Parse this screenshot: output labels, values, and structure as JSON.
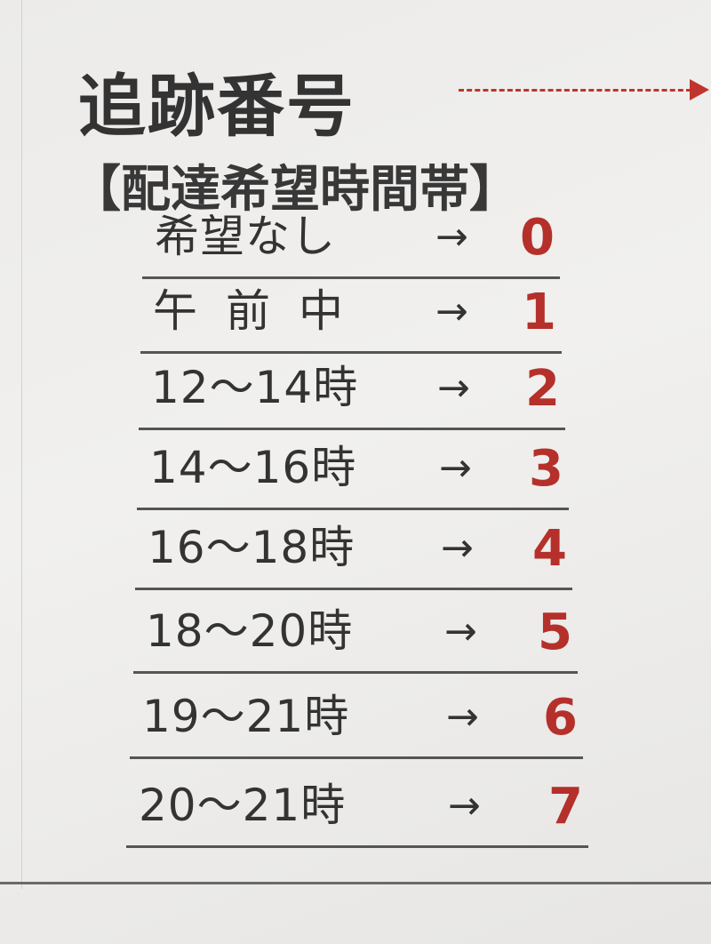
{
  "heading": {
    "title": "追跡番号",
    "subtitle": "【配達希望時間帯】"
  },
  "arrow_glyph": "→",
  "rows": [
    {
      "label": "希望なし",
      "code": "0"
    },
    {
      "label": "午前中",
      "code": "1"
    },
    {
      "label": "12〜14時",
      "code": "2"
    },
    {
      "label": "14〜16時",
      "code": "3"
    },
    {
      "label": "16〜18時",
      "code": "4"
    },
    {
      "label": "18〜20時",
      "code": "5"
    },
    {
      "label": "19〜21時",
      "code": "6"
    },
    {
      "label": "20〜21時",
      "code": "7"
    }
  ],
  "colors": {
    "text": "#333333",
    "accent_red": "#b5302a",
    "paper": "#efeeec"
  }
}
